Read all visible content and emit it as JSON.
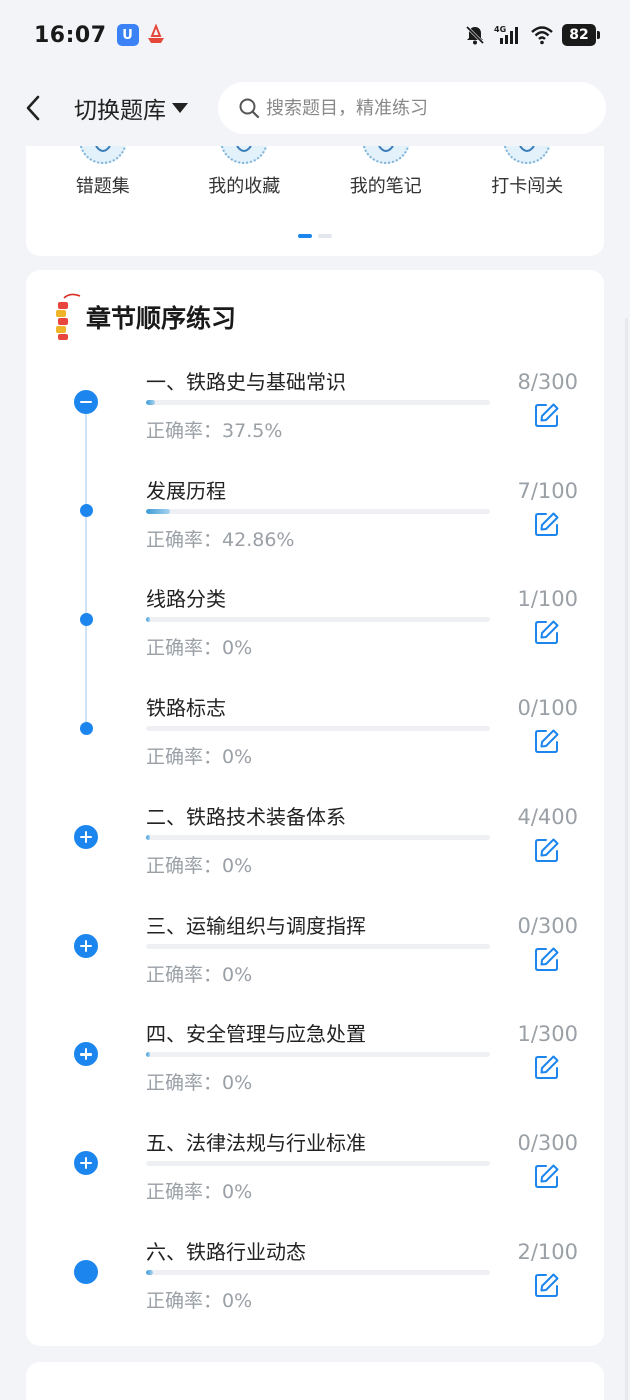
{
  "status_bar": {
    "time": "16:07",
    "network": "4G",
    "battery": "82"
  },
  "header": {
    "bank_switch_label": "切换题库",
    "search_placeholder": "搜索题目，精准练习"
  },
  "quick_access": {
    "items": [
      {
        "label": "错题集",
        "icon": "wrong-book-icon"
      },
      {
        "label": "我的收藏",
        "icon": "favorites-icon"
      },
      {
        "label": "我的笔记",
        "icon": "notes-icon"
      },
      {
        "label": "打卡闯关",
        "icon": "checkin-icon"
      }
    ],
    "pager": {
      "pages": 2,
      "active": 0
    }
  },
  "chapters": {
    "title": "章节顺序练习",
    "accuracy_prefix": "正确率：",
    "rows": [
      {
        "title": "一、铁路史与基础常识",
        "progress": "8/300",
        "accuracy": "37.5%",
        "node": "minus",
        "fill": 0.027
      },
      {
        "title": "发展历程",
        "progress": "7/100",
        "accuracy": "42.86%",
        "node": "dot",
        "fill": 0.07
      },
      {
        "title": "线路分类",
        "progress": "1/100",
        "accuracy": "0%",
        "node": "dot",
        "fill": 0.01
      },
      {
        "title": "铁路标志",
        "progress": "0/100",
        "accuracy": "0%",
        "node": "dot",
        "fill": 0
      },
      {
        "title": "二、铁路技术装备体系",
        "progress": "4/400",
        "accuracy": "0%",
        "node": "plus",
        "fill": 0.01
      },
      {
        "title": "三、运输组织与调度指挥",
        "progress": "0/300",
        "accuracy": "0%",
        "node": "plus",
        "fill": 0
      },
      {
        "title": "四、安全管理与应急处置",
        "progress": "1/300",
        "accuracy": "0%",
        "node": "plus",
        "fill": 0.003
      },
      {
        "title": "五、法律法规与行业标准",
        "progress": "0/300",
        "accuracy": "0%",
        "node": "plus",
        "fill": 0
      },
      {
        "title": "六、铁路行业动态",
        "progress": "2/100",
        "accuracy": "0%",
        "node": "filled",
        "fill": 0.02
      }
    ]
  },
  "colors": {
    "accent": "#1c86ee",
    "muted_text": "#9aa0a6",
    "background": "#f3f4f7"
  }
}
